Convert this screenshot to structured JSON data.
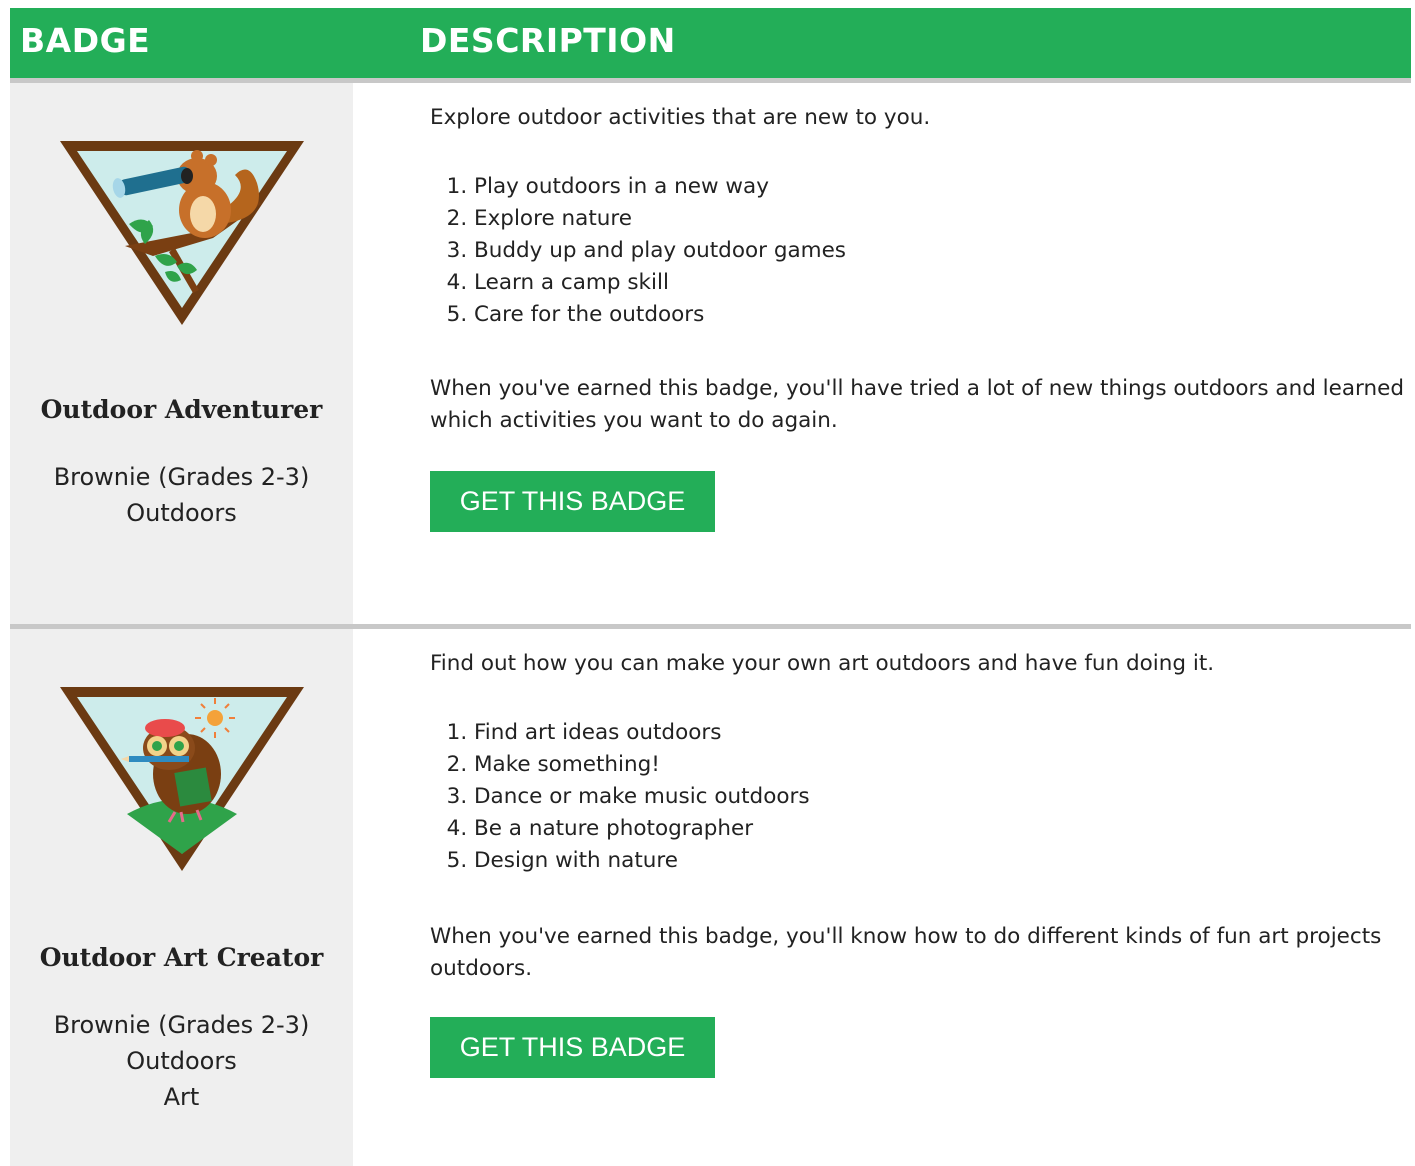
{
  "header": {
    "badge_label": "BADGE",
    "description_label": "DESCRIPTION"
  },
  "colors": {
    "brand_green": "#23ae58",
    "badge_cell_bg": "#efefef",
    "separator": "#c8c8c8",
    "badge_border_brown": "#6b3a12",
    "badge_sky": "#cdeceb"
  },
  "badges": [
    {
      "name": "Outdoor Adventurer",
      "meta": [
        "Brownie (Grades 2-3)",
        "Outdoors"
      ],
      "icon": "chipmunk-binoculars-badge-icon",
      "intro": "Explore outdoor activities that are new to you.",
      "steps": [
        "Play outdoors in a new way",
        "Explore nature",
        "Buddy up and play outdoor games",
        "Learn a camp skill",
        "Care for the outdoors"
      ],
      "outcome": "When you've earned this badge, you'll have tried a lot of new things outdoors and learned which activities you want to do again.",
      "button_label": "GET THIS BADGE"
    },
    {
      "name": "Outdoor Art Creator",
      "meta": [
        "Brownie (Grades 2-3)",
        "Outdoors",
        "Art"
      ],
      "icon": "owl-artist-badge-icon",
      "intro": "Find out how you can make your own art outdoors and have fun doing it.",
      "steps": [
        "Find art ideas outdoors",
        "Make something!",
        "Dance or make music outdoors",
        "Be a nature photographer",
        "Design with nature"
      ],
      "outcome": "When you've earned this badge, you'll know how to do different kinds of fun art projects outdoors.",
      "button_label": "GET THIS BADGE"
    }
  ]
}
